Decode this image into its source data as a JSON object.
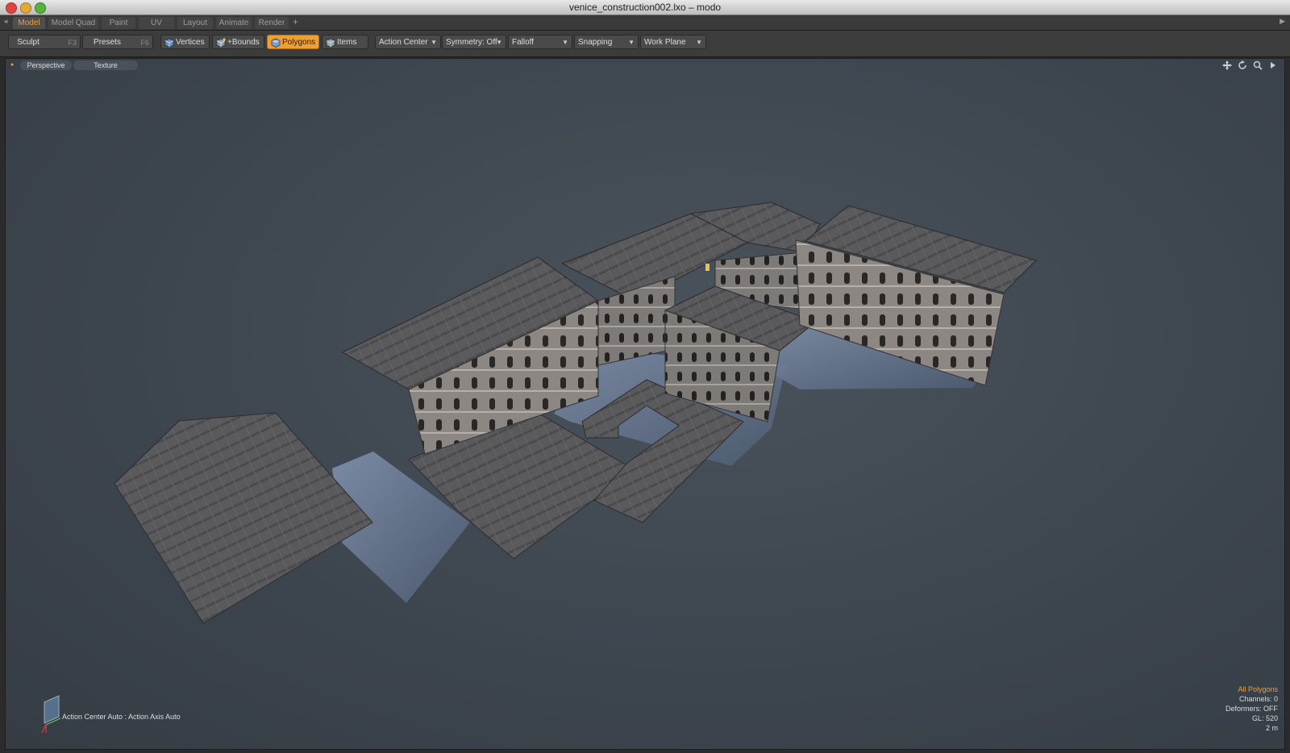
{
  "window": {
    "title": "venice_construction002.lxo – modo"
  },
  "tabs": [
    {
      "label": "Model"
    },
    {
      "label": "Model Quad"
    },
    {
      "label": "Paint"
    },
    {
      "label": "UV"
    },
    {
      "label": "Layout"
    },
    {
      "label": "Animate"
    },
    {
      "label": "Render"
    }
  ],
  "tab_add": "+",
  "toolbar": {
    "sculpt": {
      "label": "Sculpt",
      "key": "F3"
    },
    "presets": {
      "label": "Presets",
      "key": "F6"
    },
    "vertices": "Vertices",
    "bounds": "+Bounds",
    "polygons": "Polygons",
    "items": "Items",
    "action_center": "Action Center",
    "symmetry": "Symmetry: Off",
    "falloff": "Falloff",
    "snapping": "Snapping",
    "work_plane": "Work Plane"
  },
  "viewport": {
    "view": "Perspective",
    "shading": "Texture",
    "status": "Action Center Auto : Action Axis Auto",
    "stats": {
      "selection": "All Polygons",
      "channels": "Channels: 0",
      "deformers": "Deformers: OFF",
      "gl": "GL: 520",
      "scale": "2 m"
    },
    "icons": [
      "move-view-icon",
      "rotate-view-icon",
      "zoom-view-icon",
      "viewport-menu-icon"
    ]
  },
  "colors": {
    "accent": "#f0a030",
    "viewport_bg": "#3c444d",
    "toolbar_bg": "#3c3c3c"
  }
}
